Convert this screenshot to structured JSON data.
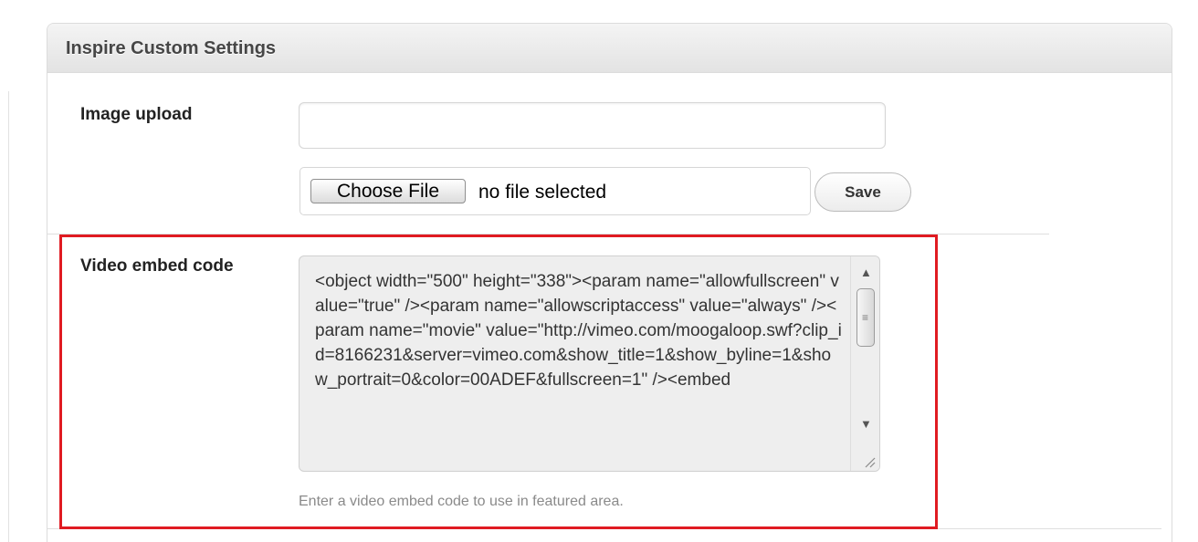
{
  "panel": {
    "title": "Inspire Custom Settings"
  },
  "image_upload": {
    "label": "Image upload",
    "url_value": "",
    "choose_file_label": "Choose File",
    "file_status": "no file selected",
    "save_label": "Save"
  },
  "video_embed": {
    "label": "Video embed code",
    "value": "<object width=\"500\" height=\"338\"><param name=\"allowfullscreen\" value=\"true\" /><param name=\"allowscriptaccess\" value=\"always\" /><param name=\"movie\" value=\"http://vimeo.com/moogaloop.swf?clip_id=8166231&server=vimeo.com&show_title=1&show_byline=1&show_portrait=0&color=00ADEF&fullscreen=1\" /><embed",
    "description": "Enter a video embed code to use in featured area."
  },
  "colors": {
    "highlight_border": "#e01b22",
    "header_bg": "#e3e3e3",
    "textarea_bg": "#eeeeee",
    "hint_text": "#8a8a8a"
  }
}
